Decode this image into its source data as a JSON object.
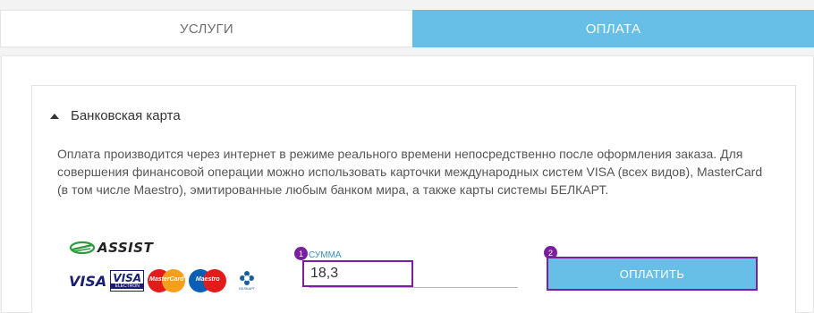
{
  "tabs": [
    {
      "label": "УСЛУГИ"
    },
    {
      "label": "ОПЛАТА"
    }
  ],
  "accordion": {
    "title": "Банковская карта",
    "description": "Оплата производится через интернет в режиме реального времени непосредственно после оформления заказа. Для совершения финансовой операции можно использовать карточки международных систем VISA (всех видов), MasterCard (в том числе Maestro), эмитированные любым банком мира, а также карты системы БЕЛКАРТ."
  },
  "logos": {
    "assist": "ASSIST",
    "visa": "VISA",
    "visa_electron_top": "VISA",
    "visa_electron_bottom": "ELECTRON",
    "mastercard": "MasterCard",
    "maestro": "Maestro",
    "belkart": "БЕЛКАРТ"
  },
  "form": {
    "sum_label": "СУММА",
    "sum_value": "18,3",
    "pay_button": "ОПЛАТИТЬ"
  },
  "annotations": {
    "badge_1": "1",
    "badge_2": "2"
  },
  "colors": {
    "accent": "#67bfe8",
    "highlight": "#7b1fa2"
  }
}
